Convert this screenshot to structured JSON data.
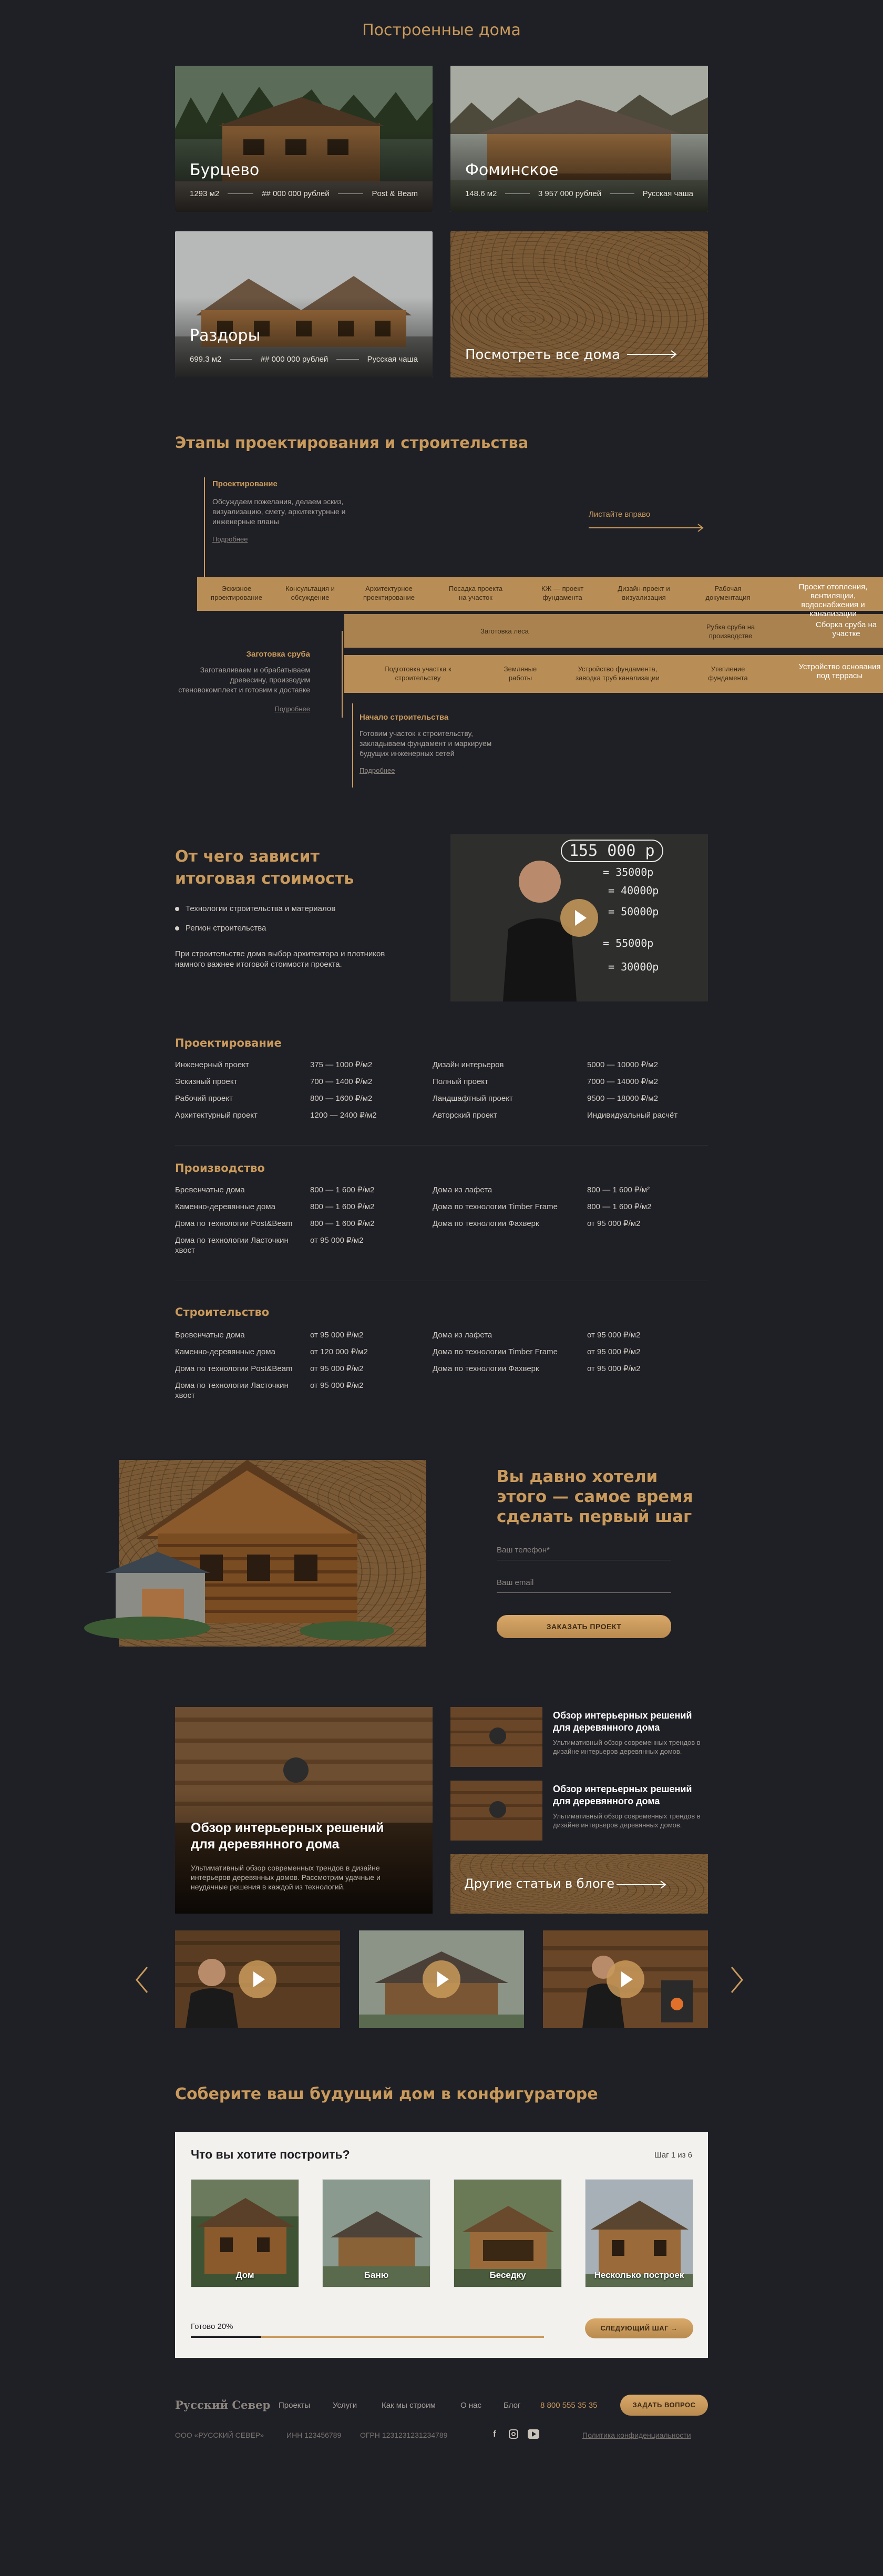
{
  "built": {
    "title": "Построенные дома",
    "houses": [
      {
        "name": "Бурцево",
        "area": "1293 м2",
        "price": "## 000 000 рублей",
        "tech": "Post & Beam"
      },
      {
        "name": "Фоминское",
        "area": "148.6 м2",
        "price": "3 957 000 рублей",
        "tech": "Русская чаша"
      },
      {
        "name": "Раздоры",
        "area": "699.3 м2",
        "price": "## 000 000 рублей",
        "tech": "Русская чаша"
      }
    ],
    "all_label": "Посмотреть все дома"
  },
  "stages": {
    "title": "Этапы проектирования и строительства",
    "design": {
      "head": "Проектирование",
      "text": "Обсуждаем пожелания, делаем эскиз, визуализацию, смету, архитектурные и инженерные планы",
      "link": "Подробнее"
    },
    "swipe": "Листайте вправо",
    "row1": [
      "Эскизное проектирование",
      "Консультация и обсуждение",
      "Архитектурное проектирование",
      "Посадка проекта на участок",
      "КЖ — проект фундамента",
      "Дизайн-проект и визуализация",
      "Рабочая документация",
      "Проект отопления, вентиляции, водоснабжения и канализации"
    ],
    "row2": [
      "Заготовка леса",
      "Рубка сруба на производстве",
      "Сборка сруба на участке"
    ],
    "row3": [
      "Подготовка участка к строительству",
      "Земляные работы",
      "Устройство фундамента, заводка труб канализации",
      "Утепление фундамента",
      "Устройство основания под террасы"
    ],
    "log": {
      "head": "Заготовка сруба",
      "text": "Заготавливаем и обрабатываем древесину, производим стеновокомплект и готовим к доставке",
      "link": "Подробнее"
    },
    "build": {
      "head": "Начало строительства",
      "text": "Готовим участок к строительству, закладываем фундамент и маркируем будущих инженерных сетей",
      "link": "Подробнее"
    }
  },
  "cost": {
    "title1": "От чего зависит",
    "title2": "итоговая стоимость",
    "bullets": [
      "Технологии строительства и материалов",
      "Регион строительства"
    ],
    "note": "При строительстве дома выбор архитектора и плотников намного важнее итоговой стоимости проекта.",
    "board": [
      "155 000 р",
      "= 35000р",
      "= 40000р",
      "= 50000р",
      "= 55000р",
      "= 30000р"
    ]
  },
  "prices": {
    "design": {
      "title": "Проектирование",
      "left": [
        [
          "Инженерный проект",
          "375 — 1000 ₽/м2"
        ],
        [
          "Эскизный проект",
          "700 — 1400 ₽/м2"
        ],
        [
          "Рабочий проект",
          "800 — 1600 ₽/м2"
        ],
        [
          "Архитектурный проект",
          "1200 — 2400 ₽/м2"
        ]
      ],
      "right": [
        [
          "Дизайн интерьеров",
          "5000 — 10000 ₽/м2"
        ],
        [
          "Полный проект",
          "7000 — 14000 ₽/м2"
        ],
        [
          "Ландшафтный проект",
          "9500 — 18000 ₽/м2"
        ],
        [
          "Авторский проект",
          "Индивидуальный расчёт"
        ]
      ]
    },
    "production": {
      "title": "Производство",
      "left": [
        [
          "Бревенчатые дома",
          "800 — 1 600 ₽/м2"
        ],
        [
          "Каменно-деревянные дома",
          "800 — 1 600 ₽/м2"
        ],
        [
          "Дома по технологии Post&Beam",
          "800 — 1 600 ₽/м2"
        ],
        [
          "Дома по технологии Ласточкин хвост",
          "от 95 000 ₽/м2"
        ]
      ],
      "right": [
        [
          "Дома из лафета",
          "800 — 1 600 ₽/м²"
        ],
        [
          "Дома по технологии Timber Frame",
          "800 — 1 600 ₽/м2"
        ],
        [
          "Дома по технологии Фахверк",
          "от 95 000 ₽/м2"
        ]
      ]
    },
    "construction": {
      "title": "Строительство",
      "left": [
        [
          "Бревенчатые дома",
          "от 95 000 ₽/м2"
        ],
        [
          "Каменно-деревянные дома",
          "от 120 000 ₽/м2"
        ],
        [
          "Дома по технологии Post&Beam",
          "от 95 000 ₽/м2"
        ],
        [
          "Дома по технологии Ласточкин хвост",
          "от 95 000 ₽/м2"
        ]
      ],
      "right": [
        [
          "Дома из лафета",
          "от 95 000 ₽/м2"
        ],
        [
          "Дома по технологии Timber Frame",
          "от 95 000 ₽/м2"
        ],
        [
          "Дома по технологии Фахверк",
          "от 95 000 ₽/м2"
        ]
      ]
    }
  },
  "cta": {
    "title": "Вы давно хотели этого — самое время сделать первый шаг",
    "phone_placeholder": "Ваш телефон*",
    "email_placeholder": "Ваш email",
    "button": "ЗАКАЗАТЬ ПРОЕКТ"
  },
  "blog": {
    "main_title": "Обзор интерьерных решений для деревянного дома",
    "main_desc": "Ультимативный обзор современных трендов в дизайне интерьеров деревянных домов. Рассмотрим удачные и неудачные решения в каждой из технологий.",
    "items": [
      {
        "title": "Обзор интерьерных решений для деревянного дома",
        "desc": "Ультимативный обзор современных трендов в дизайне интерьеров деревянных домов."
      },
      {
        "title": "Обзор интерьерных решений для деревянного дома",
        "desc": "Ультимативный обзор современных трендов в дизайне интерьеров деревянных домов."
      }
    ],
    "other": "Другие статьи в блоге"
  },
  "configurator": {
    "title": "Соберите ваш будущий дом в конфигураторе",
    "question": "Что вы хотите построить?",
    "step": "Шаг 1 из 6",
    "options": [
      "Дом",
      "Баню",
      "Беседку",
      "Несколько построек"
    ],
    "progress_label": "Готово 20%",
    "progress": 0.2,
    "next": "СЛЕДУЮЩИЙ ШАГ"
  },
  "footer": {
    "logo": "Русский Север",
    "nav": [
      "Проекты",
      "Услуги",
      "Как мы строим",
      "О нас",
      "Блог"
    ],
    "phone": "8 800 555 35 35",
    "ask": "ЗАДАТЬ ВОПРОС",
    "company": "ООО «РУССКИЙ СЕВЕР»",
    "inn": "ИНН 123456789",
    "ogrn": "ОГРН 1231231231234789",
    "privacy": "Политика конфиденциальности"
  },
  "colors": {
    "bg": "#1f1f26",
    "gold": "#c99a5b",
    "wood": "#7a5a36"
  }
}
